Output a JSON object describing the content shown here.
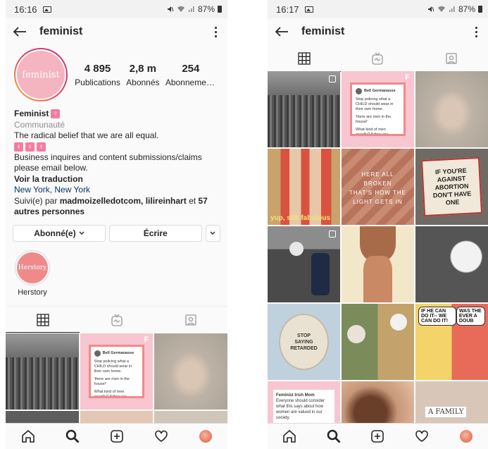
{
  "left": {
    "status": {
      "time": "16:16",
      "battery": "87%"
    },
    "header": {
      "title": "feminist"
    },
    "profile": {
      "avatar_text": "feminist",
      "stats": [
        {
          "num": "4 895",
          "label": "Publications"
        },
        {
          "num": "2,8 m",
          "label": "Abonnés"
        },
        {
          "num": "254",
          "label": "Abonnements"
        }
      ],
      "name": "Feminist",
      "category": "Communauté",
      "bio_line1": "The radical belief that we are all equal.",
      "bio_line2": "Business inquires and content submissions/claims please email below.",
      "translate": "Voir la traduction",
      "location": "New York, New York",
      "followed_prefix": "Suivi(e) par ",
      "followed_names": "madmoizelledotcom, lilireinhart",
      "followed_mid": " et ",
      "followed_others": "57 autres personnes"
    },
    "buttons": {
      "follow": "Abonné(e)",
      "message": "Écrire"
    },
    "highlight": {
      "label": "Herstory",
      "cover": "Herstory"
    }
  },
  "right": {
    "status": {
      "time": "16:17",
      "battery": "87%"
    },
    "header": {
      "title": "feminist"
    }
  },
  "tweet": {
    "name": "Bell Germanasse",
    "l1": "Stop policing what a CHILD should wear in their own home.",
    "l2": "'there are men in the house!'",
    "l3": "What kind of men exactly? If they are aroused by children then they shouldn't be in the house period."
  },
  "posts": {
    "yup_caption": "yup, still fabulous",
    "broken": "HERE ALL BROKEN\nTHAT'S HOW THE\nLIGHT GETS IN",
    "abortion": "IF YOU'RE\nAGAINST\nABORTION\nDON'T HAVE ONE",
    "retarded": "STOP\nSAYING\nRETARDED",
    "comic_left": "IF HE CAN DO IT--\nWE CAN DO IT!",
    "comic_right": "WAS THE\nEVER A\nDOUB",
    "family": "A FAMILY",
    "consider_name": "Feminist Irish Mom",
    "consider": "Everyone should consider what this says about how women are valued in our society."
  },
  "colors": {
    "accent_pink": "#f08a8a",
    "link": "#003569",
    "muted": "#8e8e8e"
  }
}
